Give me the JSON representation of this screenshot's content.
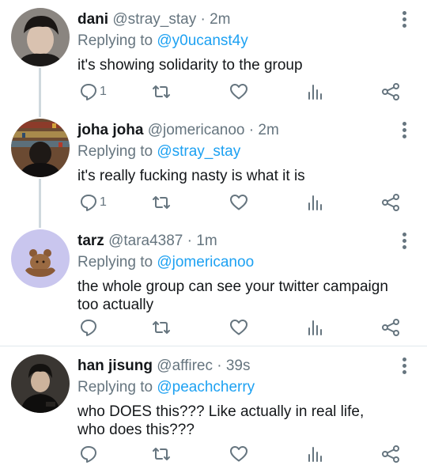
{
  "tweets": [
    {
      "name": "dani",
      "handle": "@stray_stay",
      "separator": "·",
      "time": "2m",
      "replying_prefix": "Replying to",
      "replying_to": "@y0ucanst4y",
      "text": "it's showing solidarity to the group",
      "reply_count": "1"
    },
    {
      "name": "joha joha",
      "handle": "@jomericanoo",
      "separator": "·",
      "time": "2m",
      "replying_prefix": "Replying to",
      "replying_to": "@stray_stay",
      "text": "it's really fucking nasty is what it is",
      "reply_count": "1"
    },
    {
      "name": "tarz",
      "handle": "@tara4387",
      "separator": "·",
      "time": "1m",
      "replying_prefix": "Replying to",
      "replying_to": "@jomericanoo",
      "text": "the whole group can see your twitter campaign too actually",
      "reply_count": ""
    },
    {
      "name": "han jisung",
      "handle": "@affirec",
      "separator": "·",
      "time": "39s",
      "replying_prefix": "Replying to",
      "replying_to": "@peachcherry",
      "text": "who DOES this??? Like actually in real life, who does this???",
      "reply_count": ""
    }
  ],
  "icons": {
    "reply": "reply-icon",
    "retweet": "retweet-icon",
    "like": "heart-icon",
    "analytics": "analytics-icon",
    "share": "share-icon",
    "more": "more-icon"
  },
  "colors": {
    "link": "#1da1f2",
    "muted": "#66757f",
    "thread_line": "#cfd9de"
  }
}
